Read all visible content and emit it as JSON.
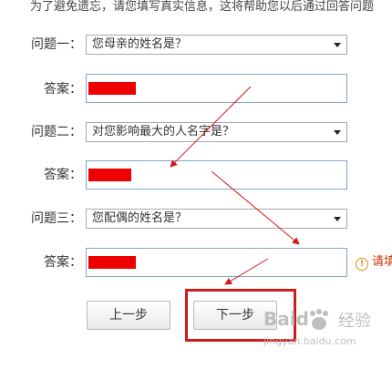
{
  "intro_text": "为了避免遗忘，请您填写真实信息，这将帮助您以后通过回答问题",
  "questions": [
    {
      "label": "问题一：",
      "selected": "您母亲的姓名是？",
      "answer_label": "答案："
    },
    {
      "label": "问题二：",
      "selected": "对您影响最大的人名字是？",
      "answer_label": "答案："
    },
    {
      "label": "问题三：",
      "selected": "您配偶的姓名是？",
      "answer_label": "答案："
    }
  ],
  "warning_text": "请填",
  "warning_icon": "warning-circle-icon",
  "buttons": {
    "prev": "上一步",
    "next": "下一步"
  },
  "watermark": {
    "brand": "Baid",
    "cn": "经验",
    "url": "jingyan.baidu.com"
  },
  "colors": {
    "redaction": "#ee0000",
    "annotation": "#d11a1a",
    "input_border": "#7fa7c9"
  }
}
